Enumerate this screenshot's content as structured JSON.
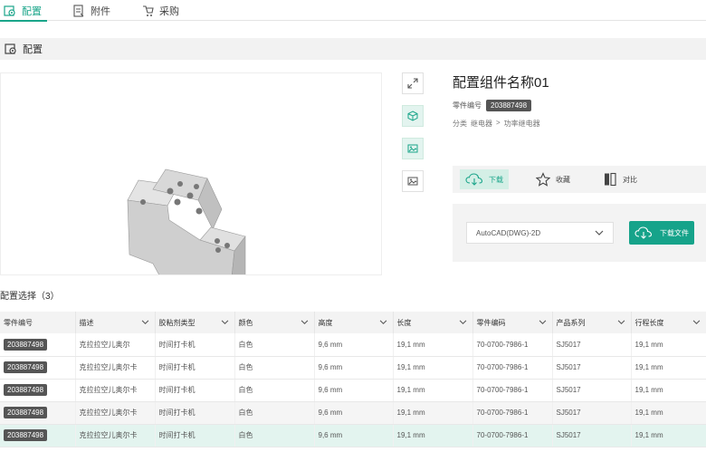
{
  "tabs": [
    {
      "label": "配置",
      "icon": "config-icon",
      "active": true
    },
    {
      "label": "附件",
      "icon": "attachment-icon",
      "active": false
    },
    {
      "label": "采购",
      "icon": "purchase-icon",
      "active": false
    }
  ],
  "section": {
    "label": "配置"
  },
  "product": {
    "title": "配置组件名称01",
    "part_label": "零件编号",
    "part_number": "203887498",
    "category_label": "分类",
    "category_path": [
      "继电器",
      ">",
      "功率继电器"
    ]
  },
  "actions": {
    "download": "下载",
    "favorite": "收藏",
    "compare": "对比"
  },
  "download_box": {
    "format": "AutoCAD(DWG)-2D",
    "button": "下载文件"
  },
  "config_title": "配置选择（3）",
  "table": {
    "headers": [
      "零件编号",
      "描述",
      "胶粘剂类型",
      "颜色",
      "高度",
      "长度",
      "零件编码",
      "产品系列",
      "行程长度"
    ],
    "rows": [
      [
        "203887498",
        "克拉拉空儿奥尔",
        "时间打卡机",
        "白色",
        "9,6 mm",
        "19,1 mm",
        "70-0700-7986-1",
        "SJ5017",
        "19,1 mm"
      ],
      [
        "203887498",
        "克拉拉空儿奥尔卡",
        "时间打卡机",
        "白色",
        "9,6 mm",
        "19,1 mm",
        "70-0700-7986-1",
        "SJ5017",
        "19,1 mm"
      ],
      [
        "203887498",
        "克拉拉空儿奥尔卡",
        "时间打卡机",
        "白色",
        "9,6 mm",
        "19,1 mm",
        "70-0700-7986-1",
        "SJ5017",
        "19,1 mm"
      ],
      [
        "203887498",
        "克拉拉空儿奥尔卡",
        "时间打卡机",
        "白色",
        "9,6 mm",
        "19,1 mm",
        "70-0700-7986-1",
        "SJ5017",
        "19,1 mm"
      ],
      [
        "203887498",
        "克拉拉空儿奥尔卡",
        "时间打卡机",
        "白色",
        "9,6 mm",
        "19,1 mm",
        "70-0700-7986-1",
        "SJ5017",
        "19,1 mm"
      ]
    ],
    "selected_row": 4
  },
  "colors": {
    "accent": "#1aa58a",
    "badge": "#555555",
    "selected_row": "#e3f4ef"
  },
  "viewer_tools": [
    "expand-icon",
    "3d-cube-icon",
    "image-icon",
    "image-icon"
  ]
}
